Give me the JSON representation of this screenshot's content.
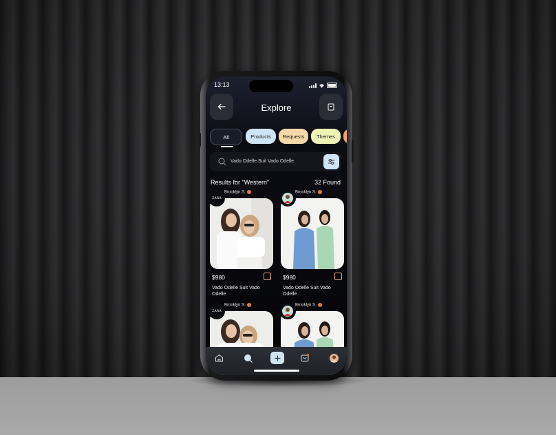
{
  "status_bar": {
    "time": "13:13"
  },
  "header": {
    "title": "Explore",
    "back_icon": "arrow-left-icon",
    "action_icon": "bookmark-icon"
  },
  "filters": [
    {
      "label": "All",
      "color": "#181c26",
      "active": true
    },
    {
      "label": "Products",
      "color": "#cfe5f6"
    },
    {
      "label": "Requests",
      "color": "#f6d9a8"
    },
    {
      "label": "Themes",
      "color": "#eef3b5"
    },
    {
      "label": "",
      "color": "#f0a070"
    }
  ],
  "search": {
    "value": "Vado Odelle Suit Vado Odelle",
    "icon": "search-icon",
    "filter_icon": "sliders-icon"
  },
  "results": {
    "label": "Results for \"Western\"",
    "count": "32 Found"
  },
  "products": [
    {
      "seller": "Brooklyn S.",
      "avatar": "ZARA",
      "price": "$980",
      "name": "Vado Odelle Suit Vado Odelle"
    },
    {
      "seller": "Brooklyn S.",
      "avatar": "",
      "price": "$980",
      "name": "Vado Odelle Suit Vado Odelle"
    },
    {
      "seller": "Brooklyn S.",
      "avatar": "ZARA",
      "price": "",
      "name": ""
    },
    {
      "seller": "Brooklyn S.",
      "avatar": "",
      "price": "",
      "name": ""
    }
  ],
  "nav": [
    "home-icon",
    "search-icon",
    "plus-icon",
    "bag-icon",
    "profile-avatar"
  ],
  "colors": {
    "accent_orange": "#e07a3a",
    "plus_button": "#cfe5f6"
  }
}
